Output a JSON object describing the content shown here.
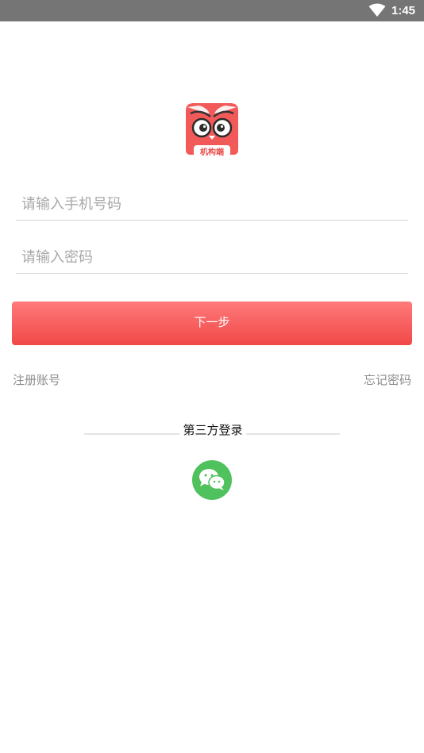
{
  "status_bar": {
    "time": "1:45",
    "wifi_icon": "wifi-icon"
  },
  "logo": {
    "icon": "owl-logo-icon",
    "caption": "机构端"
  },
  "form": {
    "phone_placeholder": "请输入手机号码",
    "phone_value": "",
    "password_placeholder": "请输入密码",
    "password_value": "",
    "next_label": "下一步"
  },
  "links": {
    "register": "注册账号",
    "forgot_password": "忘记密码"
  },
  "third_party": {
    "title": "第三方登录",
    "wechat_icon": "wechat-icon"
  },
  "colors": {
    "accent": "#f14848",
    "accent_light": "#ff7a7a",
    "wechat": "#4fc15d",
    "status_bar": "#757575"
  }
}
